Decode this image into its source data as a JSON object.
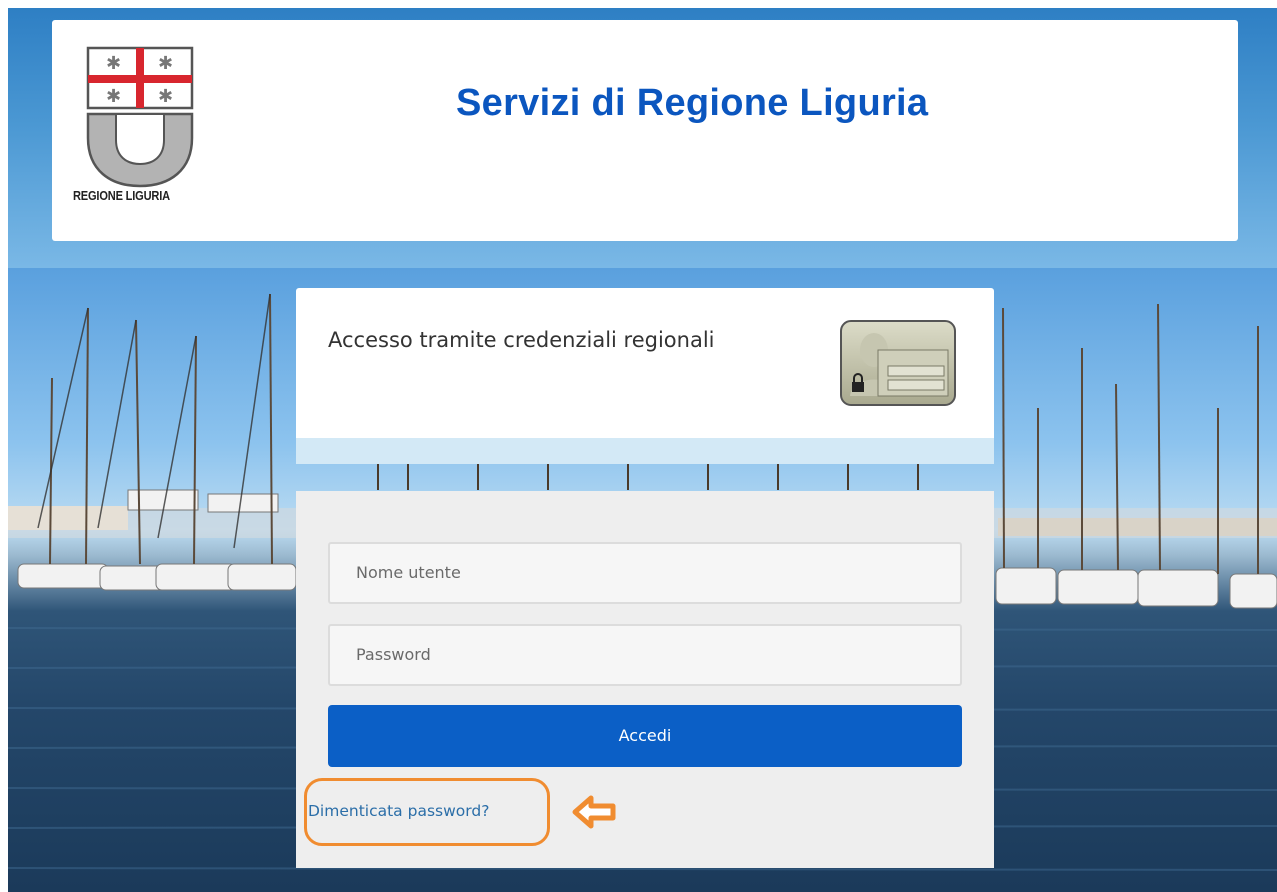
{
  "header": {
    "title": "Servizi di Regione Liguria",
    "logo_text": "REGIONE LIGURIA",
    "logo_icon": "regione-liguria-coat-of-arms"
  },
  "login": {
    "title": "Accesso tramite credenziali regionali",
    "card_icon": "id-card-lock-icon",
    "username_placeholder": "Nome utente",
    "password_placeholder": "Password",
    "submit_label": "Accedi",
    "forgot_link": "Dimenticata password?"
  },
  "annotation": {
    "highlight_color": "#f08c30",
    "arrow_icon": "left-arrow-icon"
  },
  "colors": {
    "brand_blue": "#0b56bf",
    "button_blue": "#0b5fc6",
    "link": "#2b6ea8"
  }
}
